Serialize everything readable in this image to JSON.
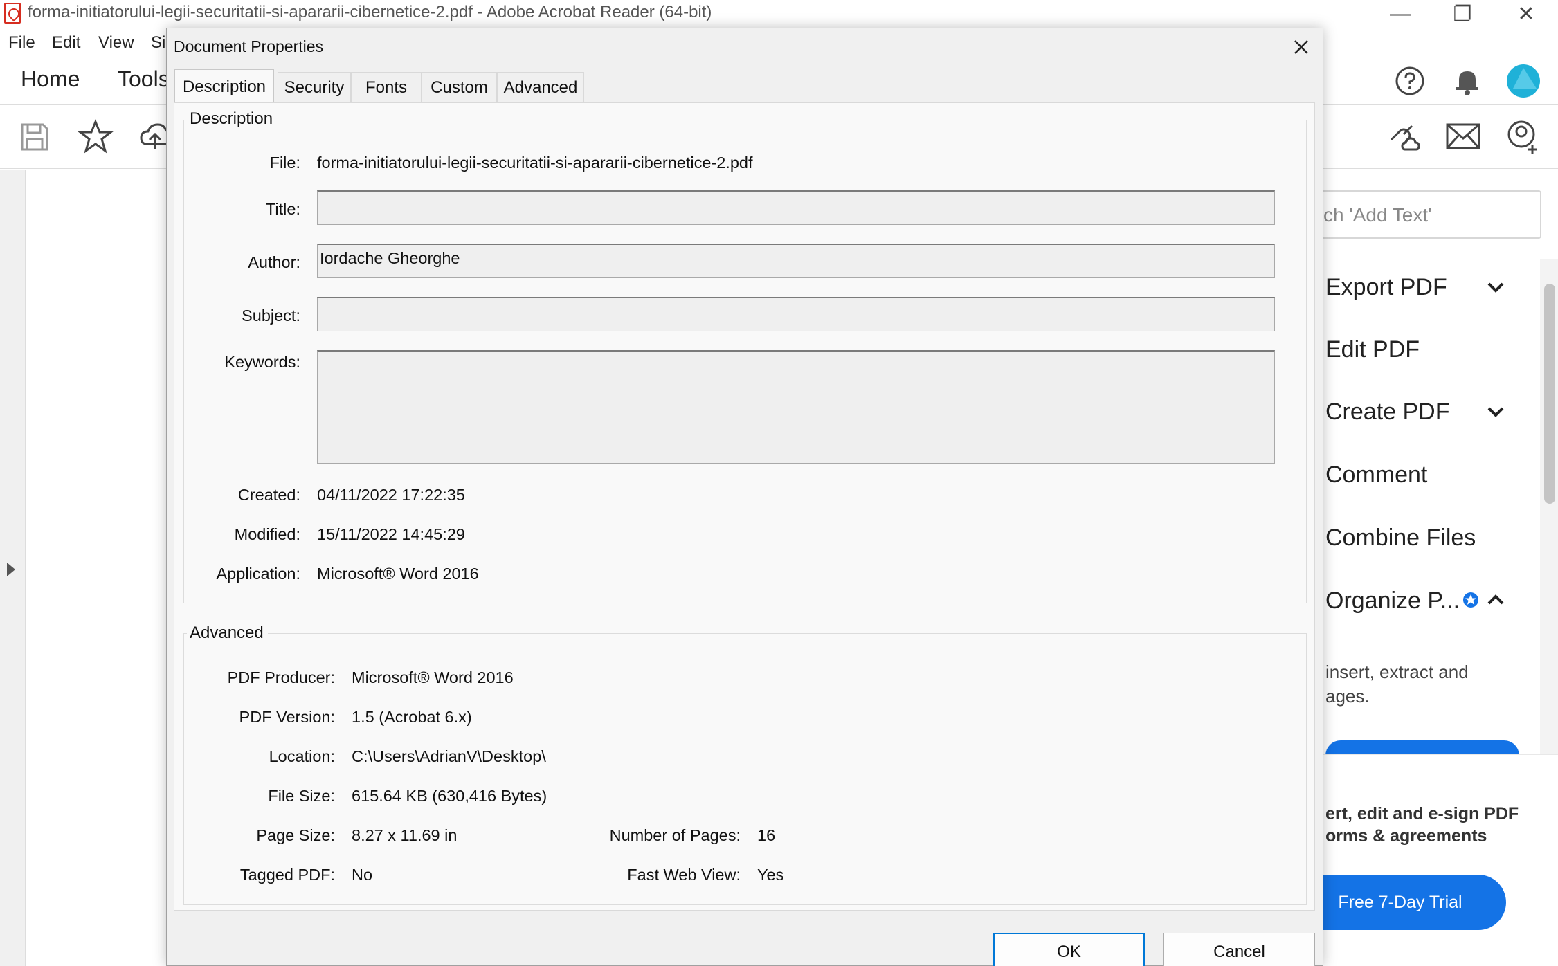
{
  "app": {
    "window_title": "forma-initiatorului-legii-securitatii-si-apararii-cibernetice-2.pdf - Adobe Acrobat Reader (64-bit)",
    "window_controls": {
      "minimize": "—",
      "restore": "❐",
      "close": "✕"
    }
  },
  "menubar": {
    "items": [
      "File",
      "Edit",
      "View",
      "Si"
    ]
  },
  "nav": {
    "home": "Home",
    "tools": "Tools"
  },
  "right_panel": {
    "search_placeholder": "ch 'Add Text'",
    "tools": [
      {
        "label": "Export PDF",
        "has_chevron": true,
        "chevron": "down"
      },
      {
        "label": "Edit PDF",
        "has_chevron": false
      },
      {
        "label": "Create PDF",
        "has_chevron": true,
        "chevron": "down"
      },
      {
        "label": "Comment",
        "has_chevron": false
      },
      {
        "label": "Combine Files",
        "has_chevron": false
      },
      {
        "label": "Organize P...",
        "has_chevron": true,
        "chevron": "up"
      }
    ],
    "organize_desc_line1": "insert, extract and",
    "organize_desc_line2": "ages.",
    "promo_line1": "ert, edit and e-sign PDF",
    "promo_line2": "orms & agreements",
    "trial_button": "Free 7-Day Trial",
    "accent_color": "#1473e6"
  },
  "dialog": {
    "title": "Document Properties",
    "tabs": [
      "Description",
      "Security",
      "Fonts",
      "Custom",
      "Advanced"
    ],
    "active_tab": "Description",
    "description_group": {
      "label": "Description",
      "file_label": "File:",
      "file_value": "forma-initiatorului-legii-securitatii-si-apararii-cibernetice-2.pdf",
      "title_label": "Title:",
      "title_value": "",
      "author_label": "Author:",
      "author_value": "Iordache Gheorghe",
      "subject_label": "Subject:",
      "subject_value": "",
      "keywords_label": "Keywords:",
      "keywords_value": "",
      "created_label": "Created:",
      "created_value": "04/11/2022 17:22:35",
      "modified_label": "Modified:",
      "modified_value": "15/11/2022 14:45:29",
      "application_label": "Application:",
      "application_value": "Microsoft® Word 2016"
    },
    "advanced_group": {
      "label": "Advanced",
      "producer_label": "PDF Producer:",
      "producer_value": "Microsoft® Word 2016",
      "version_label": "PDF Version:",
      "version_value": "1.5 (Acrobat 6.x)",
      "location_label": "Location:",
      "location_value": "C:\\Users\\AdrianV\\Desktop\\",
      "filesize_label": "File Size:",
      "filesize_value": "615.64 KB (630,416 Bytes)",
      "pagesize_label": "Page Size:",
      "pagesize_value": "8.27 x 11.69 in",
      "pages_label": "Number of Pages:",
      "pages_value": "16",
      "tagged_label": "Tagged PDF:",
      "tagged_value": "No",
      "fastweb_label": "Fast Web View:",
      "fastweb_value": "Yes"
    },
    "ok_button": "OK",
    "cancel_button": "Cancel"
  }
}
